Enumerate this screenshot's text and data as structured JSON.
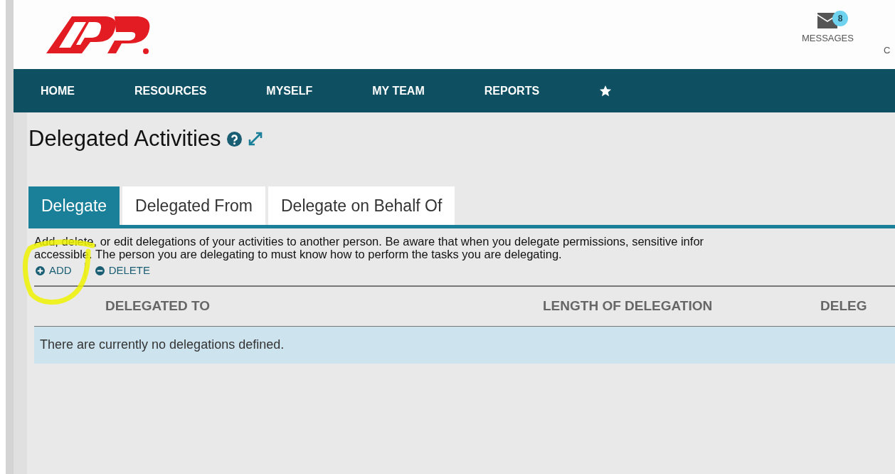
{
  "header": {
    "messages": {
      "label": "MESSAGES",
      "count": "8"
    },
    "next_item_label": "C"
  },
  "nav": {
    "items": [
      {
        "label": "HOME"
      },
      {
        "label": "RESOURCES"
      },
      {
        "label": "MYSELF"
      },
      {
        "label": "MY TEAM"
      },
      {
        "label": "REPORTS"
      }
    ]
  },
  "page": {
    "title": "Delegated Activities"
  },
  "tabs": [
    {
      "label": "Delegate",
      "selected": true
    },
    {
      "label": "Delegated From",
      "selected": false
    },
    {
      "label": "Delegate on Behalf Of",
      "selected": false
    }
  ],
  "description": "Add, delete, or edit delegations of your activities to another person. Be aware that when you delegate permissions, sensitive infor\naccessible. The person you are delegating to must know how to perform the tasks you are delegating.",
  "actions": [
    {
      "kind": "add",
      "label": "ADD"
    },
    {
      "kind": "delete",
      "label": "DELETE"
    }
  ],
  "table": {
    "columns": [
      "DELEGATED TO",
      "LENGTH OF DELEGATION",
      "DELEG"
    ],
    "empty_message": "There are currently no delegations defined."
  }
}
